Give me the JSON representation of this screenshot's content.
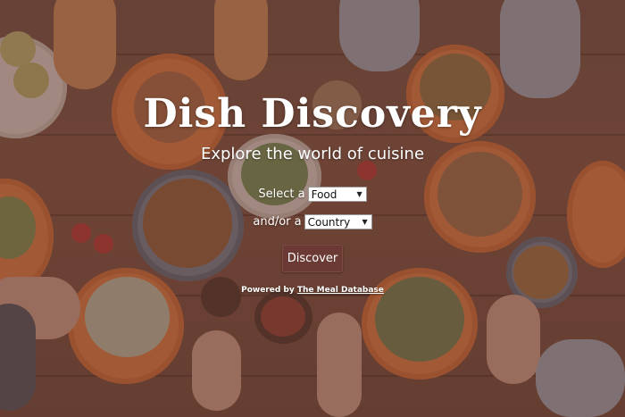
{
  "header": {
    "title": "Dish Discovery",
    "subtitle": "Explore the world of cuisine"
  },
  "form": {
    "select_label": "Select a",
    "food_select_value": "Food",
    "andor_label": "and/or a",
    "country_select_value": "Country",
    "discover_label": "Discover"
  },
  "footer": {
    "powered_prefix": "Powered by",
    "powered_link": "The Meal Database"
  },
  "colors": {
    "overlay": "#5f3732",
    "button_bg": "#6b3a35",
    "text": "#ffffff"
  },
  "icons": {
    "dropdown": "chevron-down-icon"
  }
}
